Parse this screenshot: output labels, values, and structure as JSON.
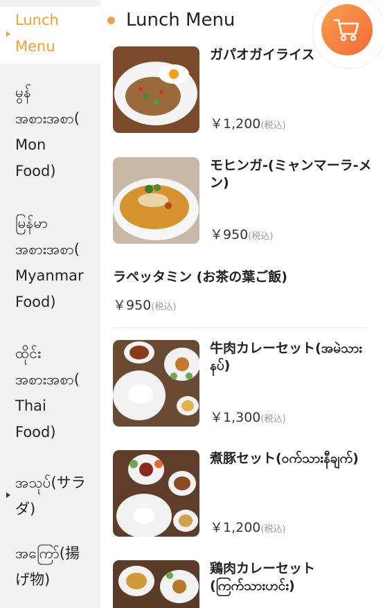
{
  "sidebar": {
    "items": [
      {
        "lines": [
          "Lunch",
          "Menu"
        ],
        "active": true,
        "arrow": true
      },
      {
        "lines": [
          "မွန်",
          "အစားအစာ(",
          "Mon",
          "Food)"
        ],
        "active": false,
        "arrow": false
      },
      {
        "lines": [
          "မြန်မာ",
          "အစားအစာ(",
          "Myanmar",
          "Food)"
        ],
        "active": false,
        "arrow": false
      },
      {
        "lines": [
          "ထိုင်း",
          "အစားအစာ(",
          "Thai",
          "Food)"
        ],
        "active": false,
        "arrow": false
      },
      {
        "lines": [
          "အသုပ်(サラ",
          "ダ)"
        ],
        "active": false,
        "arrow": true
      },
      {
        "lines": [
          "အကြော်(揚",
          "げ物)"
        ],
        "active": false,
        "arrow": false
      }
    ]
  },
  "header": {
    "title": "Lunch Menu",
    "accent_color": "#f0a04a"
  },
  "cart": {
    "icon": "cart-icon"
  },
  "tax_label": "(税込)",
  "items": [
    {
      "name": "ガパオガイライス",
      "price": "￥1,200",
      "tax": "(税込)"
    },
    {
      "name": "モヒンガ-(ミャンマーラ-メン)",
      "price": "￥950",
      "tax": "(税込)"
    },
    {
      "name": "ラペッタミン (お茶の葉ご飯)",
      "price": "￥950",
      "tax": "(税込)"
    },
    {
      "name": "牛肉カレーセット(အမဲသားနပ်)",
      "price": "￥1,300",
      "tax": "(税込)"
    },
    {
      "name": "煮豚セット(ဝက်သားနီချက်)",
      "price": "￥1,200",
      "tax": "(税込)"
    },
    {
      "name": "鶏肉カレーセット(ကြက်သားဟင်း)",
      "price": "",
      "tax": ""
    }
  ]
}
